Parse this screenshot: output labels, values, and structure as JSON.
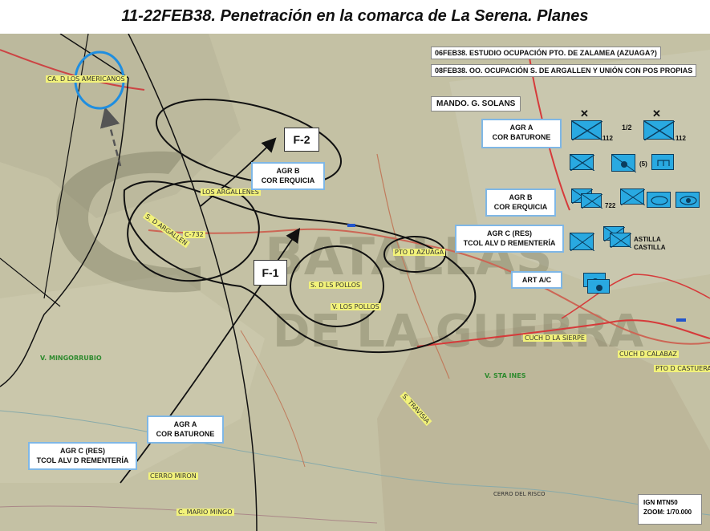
{
  "title": "11-22FEB38. Penetración en la comarca de La Serena. Planes",
  "colors": {
    "map_bg": "#c4c1a4",
    "front_line": "#d63a3a",
    "unit_fill": "#29a9e1",
    "road": "#cc6655",
    "highlight": "#f2f27a"
  },
  "notes": {
    "note1": "06FEB38. ESTUDIO OCUPACIÓN PTO. DE ZALAMEA (AZUAGA?)",
    "note2": "08FEB38. OO. OCUPACIÓN S. DE ARGALLEN Y UNIÓN CON POS PROPIAS"
  },
  "command": "MANDO. G. SOLANS",
  "phases": {
    "f1": "F-1",
    "f2": "F-2"
  },
  "groups": {
    "agr_a": {
      "line1": "AGR A",
      "line2": "COR BATURONE"
    },
    "agr_b": {
      "line1": "AGR B",
      "line2": "COR ERQUICIA"
    },
    "agr_c": {
      "line1": "AGR C (RES)",
      "line2": "TCOL ALV D REMENTERÍA"
    },
    "art": "ART A/C"
  },
  "unit_labels": {
    "n112a": "112",
    "n112b": "112",
    "half": "1/2",
    "n5": "(5)",
    "n722": "722",
    "castilla": "CASTILLA",
    "astilla": "ASTILLA"
  },
  "places": {
    "americanos": "CA. D LOS AMERICANOS",
    "argallenes": "LOS ARGALLENES",
    "s_argallen": "S. D ARGALLEN",
    "c732": "C-732",
    "pto_azuaga": "PTO D AZUAGA",
    "s_pollos": "S. D LS POLLOS",
    "v_pollos": "V. LOS POLLOS",
    "mingorrubio": "V. MINGORRUBIO",
    "sta_ines": "V. STA INES",
    "cuchi_sierpe": "CUCH D LA SIERPE",
    "cuch_calabaza": "CUCH D CALABAZ",
    "pto_castuera": "PTO D CASTUERA",
    "travisia": "S. TRAVISIA",
    "cerro_miron": "CERRO MIRON",
    "mario_mingo": "C. MARIO MINGO",
    "cerro_risco": "CERRO DEL RISCO"
  },
  "scale": {
    "source": "IGN MTN50",
    "zoom": "ZOOM: 1/70.000"
  }
}
